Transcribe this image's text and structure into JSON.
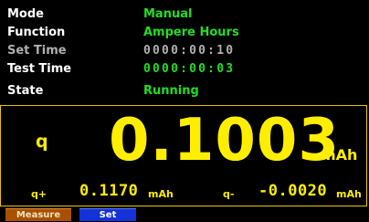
{
  "info_rows": {
    "mode": {
      "label": "Mode",
      "value": "Manual"
    },
    "function": {
      "label": "Function",
      "value": "Ampere Hours"
    },
    "set_time": {
      "label": "Set Time",
      "value": "0000:00:10"
    },
    "test_time": {
      "label": "Test Time",
      "value": "0000:00:03"
    },
    "state": {
      "label": "State",
      "value": "Running"
    }
  },
  "measurement": {
    "main_label": "q",
    "main_value": "0.1003",
    "main_unit": "mAh",
    "q_plus_label": "q+",
    "q_plus_value": "0.1170",
    "q_plus_unit": "mAh",
    "q_minus_label": "q-",
    "q_minus_value": "-0.0020",
    "q_minus_unit": "mAh"
  },
  "tabs": {
    "measure_label": "Measure",
    "set_label": "Set"
  },
  "colors": {
    "value_green": "#22dd22",
    "measure_yellow": "#ffee00",
    "measure_tab_orange": "#a85000",
    "set_tab_blue": "#1432d8",
    "dim_gray": "#b0b0b0"
  }
}
